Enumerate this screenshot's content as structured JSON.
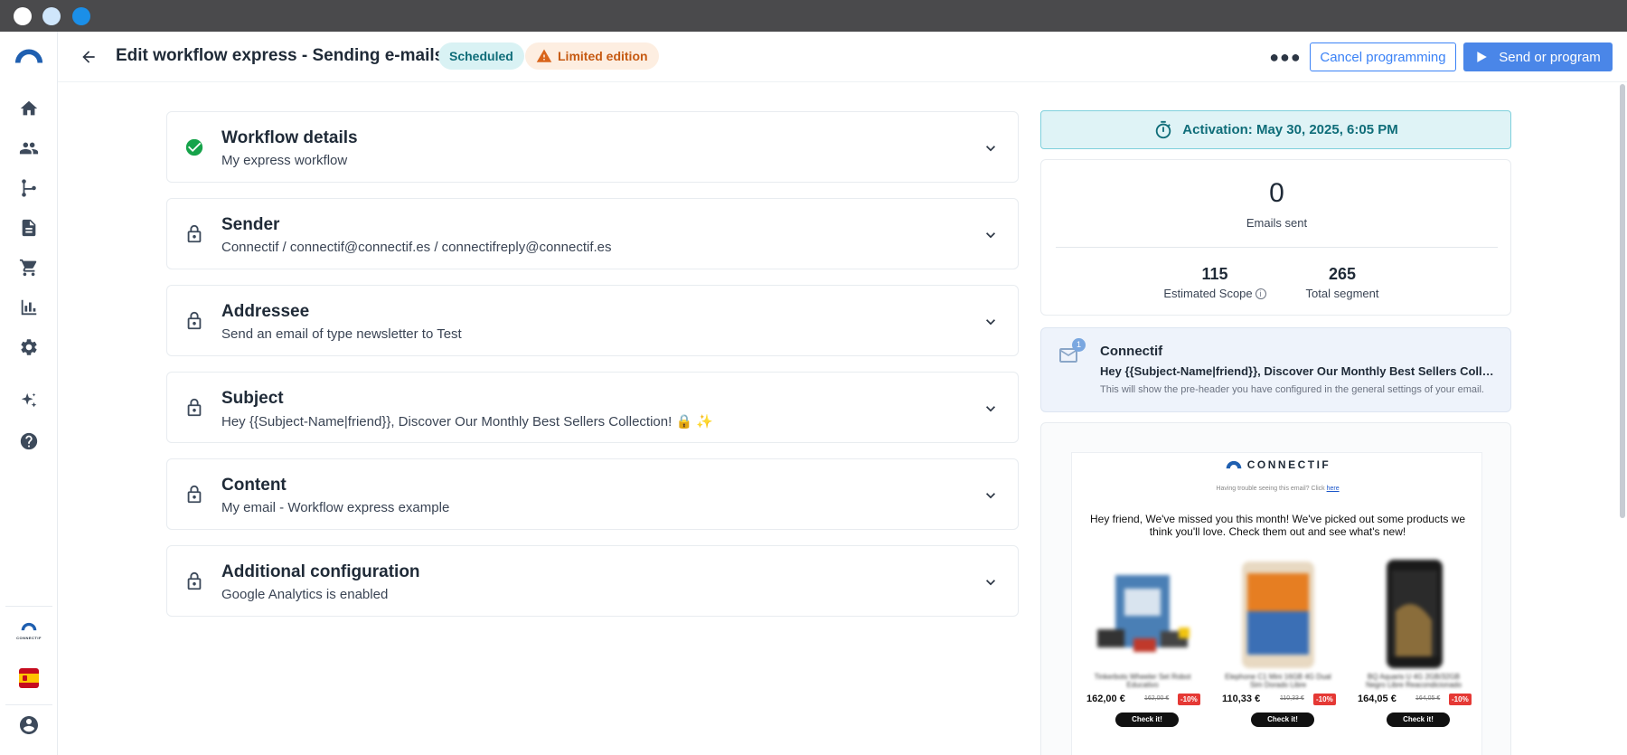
{
  "window": {
    "controls": [
      "close",
      "minimize",
      "maximize"
    ]
  },
  "sidebar": {
    "items": [
      {
        "name": "home-icon"
      },
      {
        "name": "contacts-icon"
      },
      {
        "name": "workflows-icon"
      },
      {
        "name": "content-icon"
      },
      {
        "name": "cart-icon"
      },
      {
        "name": "analytics-icon"
      },
      {
        "name": "settings-icon"
      },
      {
        "name": "ai-sparkle-icon"
      },
      {
        "name": "help-icon"
      }
    ],
    "account_logo_text": "CONNECTIF",
    "language_flag": "ES"
  },
  "header": {
    "title": "Edit workflow express - Sending e-mails",
    "status_badge": "Scheduled",
    "edition_badge": "Limited edition",
    "more_icon": "more-horizontal-icon",
    "cancel_label": "Cancel programming",
    "send_label": "Send or program"
  },
  "sections": [
    {
      "title": "Workflow details",
      "subtitle": "My express workflow",
      "state": "completed"
    },
    {
      "title": "Sender",
      "subtitle": "Connectif / connectif@connectif.es / connectifreply@connectif.es",
      "state": "locked"
    },
    {
      "title": "Addressee",
      "subtitle": "Send an email of type newsletter to Test",
      "state": "locked"
    },
    {
      "title": "Subject",
      "subtitle": "Hey {{Subject-Name|friend}}, Discover Our Monthly Best Sellers Collection! 🔒 ✨",
      "state": "locked"
    },
    {
      "title": "Content",
      "subtitle": "My email - Workflow express example",
      "state": "locked"
    },
    {
      "title": "Additional configuration",
      "subtitle": "Google Analytics is enabled",
      "state": "locked"
    }
  ],
  "activation": {
    "label": "Activation: May 30, 2025, 6:05 PM"
  },
  "stats": {
    "emails_sent": "0",
    "emails_sent_label": "Emails sent",
    "estimated_scope": "115",
    "estimated_scope_label": "Estimated Scope",
    "total_segment": "265",
    "total_segment_label": "Total segment"
  },
  "inbox_preview": {
    "unread_count": "1",
    "sender": "Connectif",
    "subject": "Hey {{Subject-Name|friend}}, Discover Our Monthly Best Sellers Collection! 🔒 ✨",
    "preheader": "This will show the pre-header you have configured in the general settings of your email."
  },
  "email_preview": {
    "logo_text": "CONNECTIF",
    "trouble_text": "Having trouble seeing this email? Click ",
    "trouble_link": "here",
    "message": "Hey friend, We've missed you this month! We've picked out some products we think you'll love. Check them out and see what's new!",
    "products": [
      {
        "name": "Tinkerbots Wheeler Set Robot Educativo",
        "price": "162,00 €",
        "old_price": "162,00 €",
        "discount": "-10%",
        "cta": "Check it!"
      },
      {
        "name": "Elephone C1 Mini 16GB 4G Dual Sim Dorado Libre",
        "price": "110,33 €",
        "old_price": "110,33 €",
        "discount": "-10%",
        "cta": "Check it!"
      },
      {
        "name": "BQ Aquaris U 4G 2GB/32GB Negro Libre Reacondicionado",
        "price": "164,05 €",
        "old_price": "164,05 €",
        "discount": "-10%",
        "cta": "Check it!"
      }
    ]
  },
  "colors": {
    "primary": "#4a86e8",
    "teal": "#0f6d79",
    "warning": "#d9651b",
    "success": "#16a34a"
  }
}
